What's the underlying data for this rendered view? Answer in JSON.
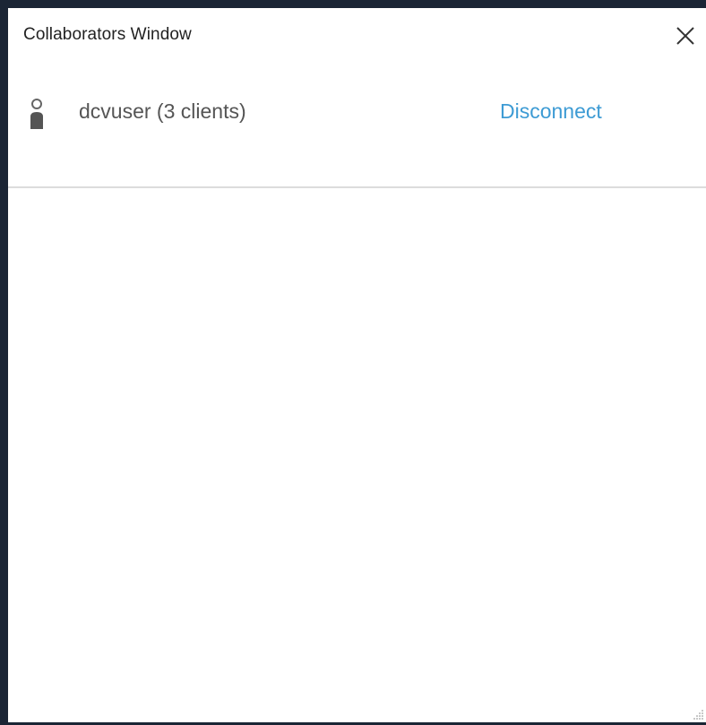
{
  "window": {
    "title": "Collaborators Window"
  },
  "collaborators": [
    {
      "name": "dcvuser (3 clients)",
      "action_label": "Disconnect"
    }
  ],
  "icons": {
    "close": "close-icon",
    "user": "user-icon",
    "resize": "resize-grip-icon"
  },
  "colors": {
    "link": "#3d9bd4",
    "frame": "#1b2535",
    "divider": "#dcdcdc"
  }
}
